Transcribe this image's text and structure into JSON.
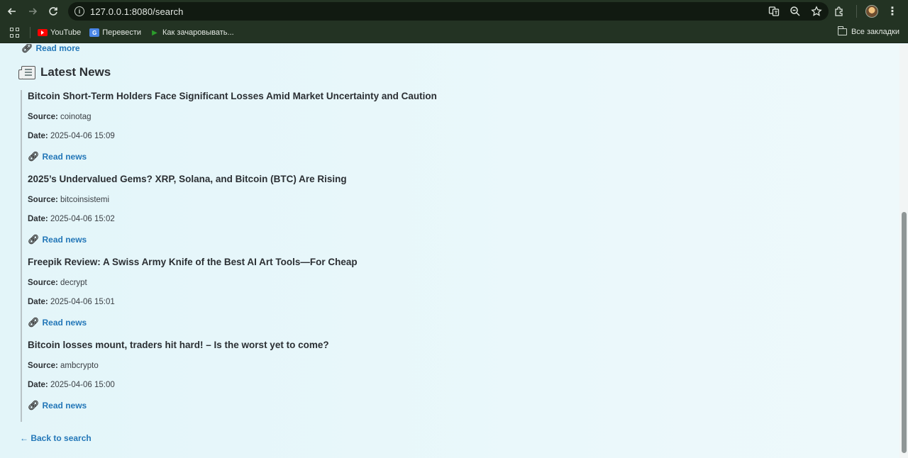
{
  "browser": {
    "url": "127.0.0.1:8080/search",
    "bookmarks": [
      {
        "label": "YouTube",
        "icon": "youtube-icon"
      },
      {
        "label": "Перевести",
        "icon": "translate-icon"
      },
      {
        "label": "Как зачаровывать...",
        "icon": "play-icon"
      }
    ],
    "all_bookmarks_label": "Все закладки"
  },
  "page": {
    "read_more_label": "Read more",
    "latest_news_title": "Latest News",
    "source_label": "Source:",
    "date_label": "Date:",
    "read_news_label": "Read news",
    "back_label": "← Back to search",
    "news": [
      {
        "title": "Bitcoin Short-Term Holders Face Significant Losses Amid Market Uncertainty and Caution",
        "source": "coinotag",
        "date": "2025-04-06 15:09"
      },
      {
        "title": "2025’s Undervalued Gems? XRP, Solana, and Bitcoin (BTC) Are Rising",
        "source": "bitcoinsistemi",
        "date": "2025-04-06 15:02"
      },
      {
        "title": "Freepik Review: A Swiss Army Knife of the Best AI Art Tools—For Cheap",
        "source": "decrypt",
        "date": "2025-04-06 15:01"
      },
      {
        "title": "Bitcoin losses mount, traders hit hard! – Is the worst yet to come?",
        "source": "ambcrypto",
        "date": "2025-04-06 15:00"
      }
    ]
  },
  "colors": {
    "link": "#2377b8",
    "chrome": "#233323",
    "page_bg": "#e6f6fa"
  }
}
